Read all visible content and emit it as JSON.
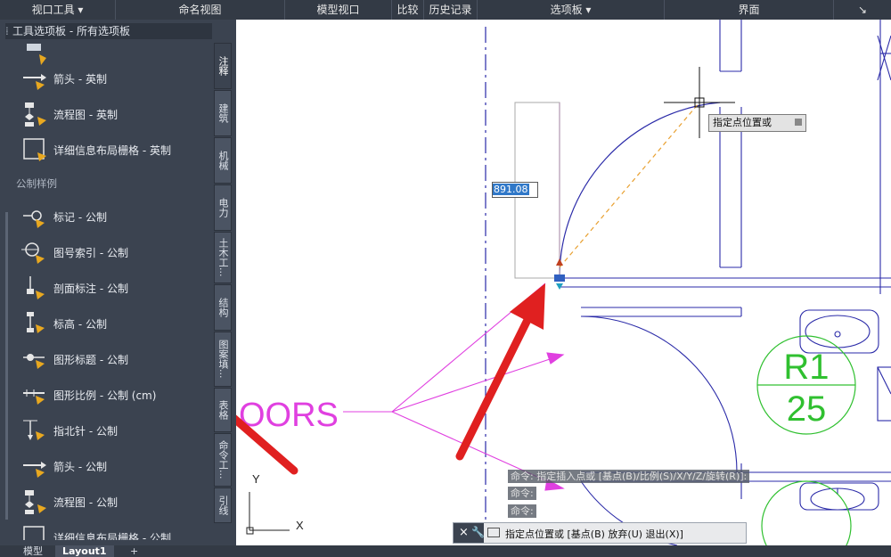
{
  "ribbon": {
    "items": [
      {
        "label": "视口工具 ▾"
      },
      {
        "label": "命名视图"
      },
      {
        "label": "模型视口"
      },
      {
        "label": "比较"
      },
      {
        "label": "历史记录"
      },
      {
        "label": "选项板 ▾"
      },
      {
        "label": "界面"
      },
      {
        "label": "↘"
      }
    ]
  },
  "palette": {
    "title": "工具选项板 - 所有选项板",
    "tools_top": [
      {
        "label": "箭头 - 英制"
      },
      {
        "label": "流程图 - 英制"
      },
      {
        "label": "详细信息布局栅格 - 英制"
      }
    ],
    "section_label": "公制样例",
    "tools_metric": [
      {
        "label": "标记 - 公制"
      },
      {
        "label": "图号索引 - 公制"
      },
      {
        "label": "剖面标注 - 公制"
      },
      {
        "label": "标高 - 公制"
      },
      {
        "label": "图形标题 - 公制"
      },
      {
        "label": "图形比例 - 公制 (cm)"
      },
      {
        "label": "指北针 - 公制"
      },
      {
        "label": "箭头 - 公制"
      },
      {
        "label": "流程图 - 公制"
      },
      {
        "label": "详细信息布局栅格 - 公制"
      }
    ],
    "tabs": [
      {
        "label": "注释"
      },
      {
        "label": "建筑"
      },
      {
        "label": "机械"
      },
      {
        "label": "电力"
      },
      {
        "label": "土木工..."
      },
      {
        "label": "结构"
      },
      {
        "label": "图案填..."
      },
      {
        "label": "表格"
      },
      {
        "label": "命令工..."
      },
      {
        "label": "引线"
      }
    ]
  },
  "drawing": {
    "tooltip": "指定点位置或",
    "dimension_value": "891.08",
    "text_doors": "OORS",
    "circle_label_top": "R1",
    "circle_label_bottom": "25",
    "ucs_x": "X",
    "ucs_y": "Y"
  },
  "command": {
    "history": [
      "命令:   指定插入点或 [基点(B)/比例(S)/X/Y/Z/旋转(R)]:",
      "命令:",
      "命令:"
    ],
    "prompt": "指定点位置或 [基点(B) 放弃(U) 退出(X)]"
  },
  "status": {
    "tabs": [
      {
        "label": "模型"
      },
      {
        "label": "Layout1"
      },
      {
        "label": "+"
      }
    ]
  },
  "colors": {
    "panel": "#3b4350",
    "ribbon": "#333a45",
    "wall": "#2a2aa8",
    "magenta": "#e040e0",
    "green": "#30c030",
    "arrow_red": "#e02020"
  }
}
